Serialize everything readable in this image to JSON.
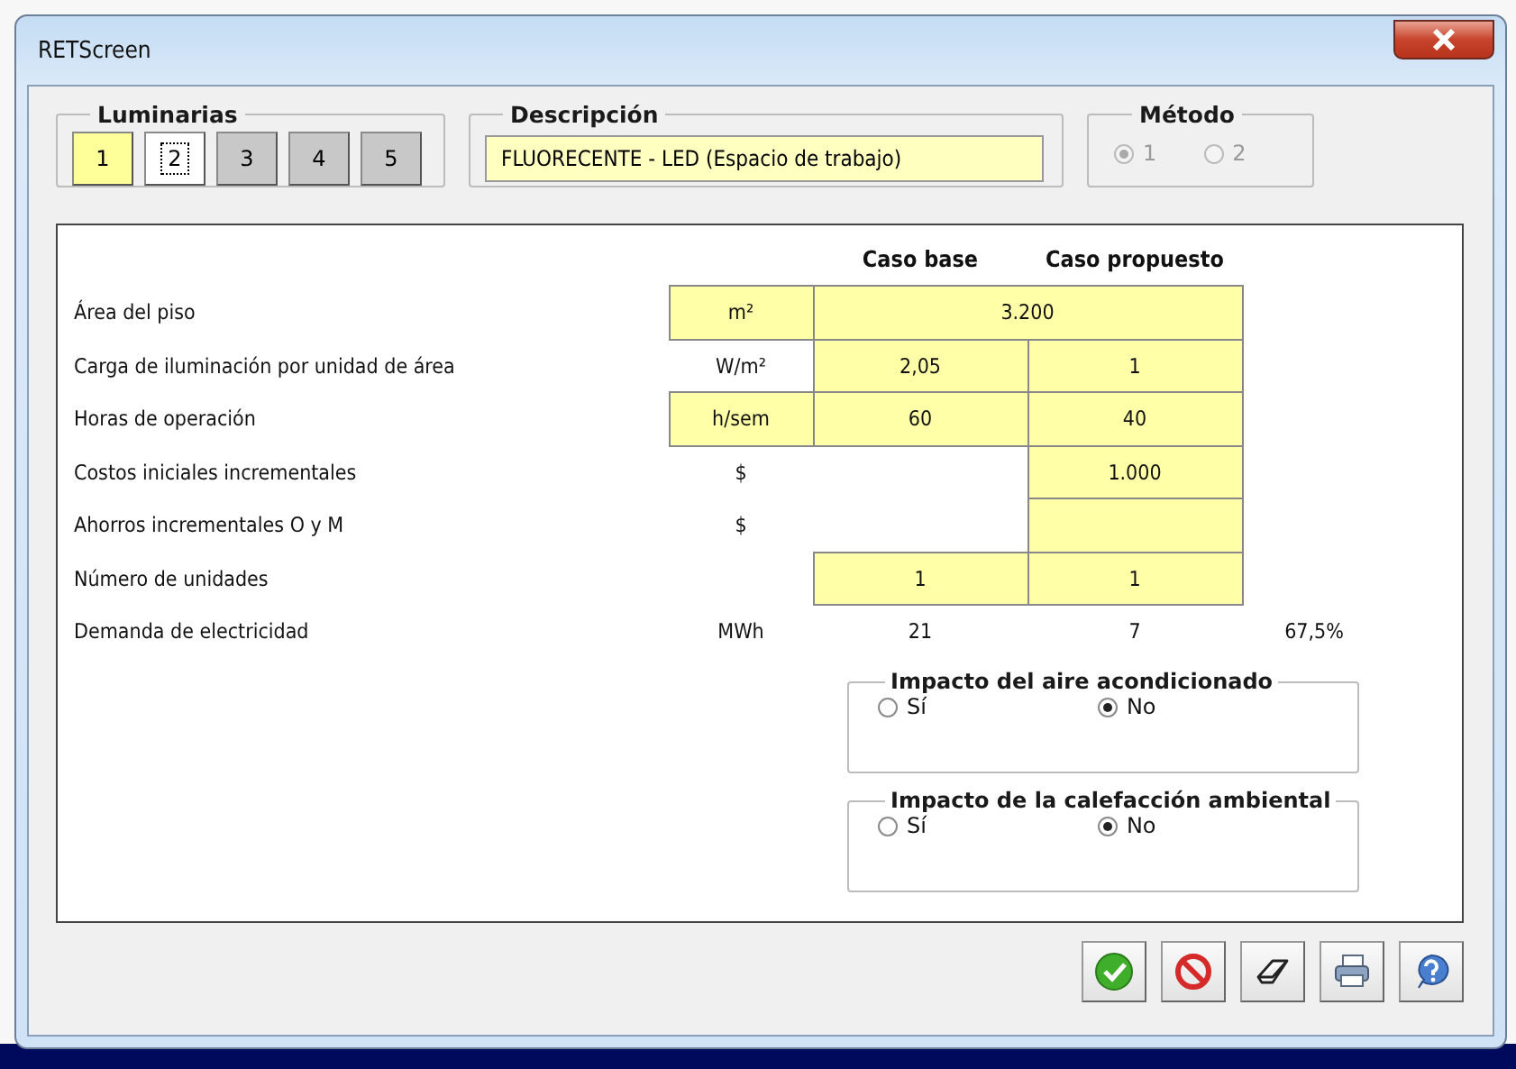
{
  "window": {
    "title": "RETScreen"
  },
  "luminarias": {
    "title": "Luminarias",
    "buttons": [
      {
        "label": "1",
        "selected": false,
        "kind": "filled"
      },
      {
        "label": "2",
        "selected": true,
        "kind": "plain"
      },
      {
        "label": "3",
        "selected": false,
        "kind": "plain"
      },
      {
        "label": "4",
        "selected": false,
        "kind": "plain"
      },
      {
        "label": "5",
        "selected": false,
        "kind": "plain"
      }
    ]
  },
  "descripcion": {
    "title": "Descripción",
    "value": "FLUORECENTE - LED (Espacio de trabajo)"
  },
  "metodo": {
    "title": "Método",
    "disabled": true,
    "options": [
      {
        "label": "1",
        "selected": true
      },
      {
        "label": "2",
        "selected": false
      }
    ]
  },
  "table": {
    "columns": [
      "",
      "Caso base",
      "Caso propuesto"
    ],
    "rows": [
      {
        "label": "Área del piso",
        "cells": [
          {
            "kind": "input",
            "text": "m²"
          },
          {
            "kind": "input-wide",
            "text": "3.200"
          },
          {
            "kind": "blank"
          }
        ]
      },
      {
        "label": "Carga de iluminación por unidad de área",
        "cells": [
          {
            "kind": "text",
            "text": "W/m²"
          },
          {
            "kind": "input",
            "text": "2,05"
          },
          {
            "kind": "input",
            "text": "1"
          },
          {
            "kind": "blank"
          }
        ]
      },
      {
        "label": "Horas de operación",
        "cells": [
          {
            "kind": "input",
            "text": "h/sem"
          },
          {
            "kind": "input",
            "text": "60"
          },
          {
            "kind": "input",
            "text": "40"
          },
          {
            "kind": "blank"
          }
        ]
      },
      {
        "label": "Costos iniciales incrementales",
        "cells": [
          {
            "kind": "text",
            "text": "$"
          },
          {
            "kind": "blank"
          },
          {
            "kind": "input",
            "text": "1.000"
          },
          {
            "kind": "blank"
          }
        ]
      },
      {
        "label": "Ahorros incrementales O y M",
        "cells": [
          {
            "kind": "text",
            "text": "$"
          },
          {
            "kind": "blank"
          },
          {
            "kind": "input"
          },
          {
            "kind": "blank"
          }
        ]
      },
      {
        "label": "Número de unidades",
        "cells": [
          {
            "kind": "blank"
          },
          {
            "kind": "input",
            "text": "1"
          },
          {
            "kind": "input",
            "text": "1"
          },
          {
            "kind": "blank"
          }
        ]
      },
      {
        "label": "Demanda de electricidad",
        "cells": [
          {
            "kind": "text",
            "text": "MWh"
          },
          {
            "kind": "text",
            "text": "21"
          },
          {
            "kind": "text",
            "text": "7"
          },
          {
            "kind": "text",
            "text": "67,5%"
          }
        ]
      }
    ]
  },
  "impacts": [
    {
      "title": "Impacto del aire acondicionado",
      "options": [
        {
          "label": "Sí",
          "selected": false
        },
        {
          "label": "No",
          "selected": true
        }
      ]
    },
    {
      "title": "Impacto de la calefacción ambiental",
      "options": [
        {
          "label": "Sí",
          "selected": false
        },
        {
          "label": "No",
          "selected": true
        }
      ]
    }
  ],
  "toolbar": [
    {
      "kind": "ok"
    },
    {
      "kind": "cancel"
    },
    {
      "kind": "erase"
    },
    {
      "kind": "print"
    },
    {
      "kind": "help"
    }
  ]
}
